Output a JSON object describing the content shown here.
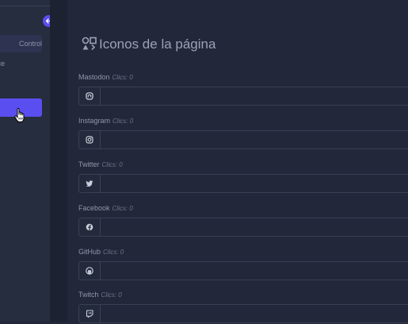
{
  "sidebar": {
    "items": [
      {
        "label": "Control",
        "active": true
      },
      {
        "label": "ace",
        "active": false
      }
    ],
    "back_icon": "arrow-left-icon",
    "accent": "#5b4ef0"
  },
  "main": {
    "title": "Iconos de la página",
    "title_icon": "icons-shapes-icon",
    "clicks_label": "Clics: 0",
    "fields": [
      {
        "name": "Mastodon",
        "clicks": "Clics: 0",
        "icon": "mastodon-icon"
      },
      {
        "name": "Instagram",
        "clicks": "Clics: 0",
        "icon": "instagram-icon"
      },
      {
        "name": "Twitter",
        "clicks": "Clics: 0",
        "icon": "twitter-icon"
      },
      {
        "name": "Facebook",
        "clicks": "Clics: 0",
        "icon": "facebook-icon"
      },
      {
        "name": "GitHub",
        "clicks": "Clics: 0",
        "icon": "github-icon"
      },
      {
        "name": "Twitch",
        "clicks": "Clics: 0",
        "icon": "twitch-icon"
      }
    ]
  }
}
